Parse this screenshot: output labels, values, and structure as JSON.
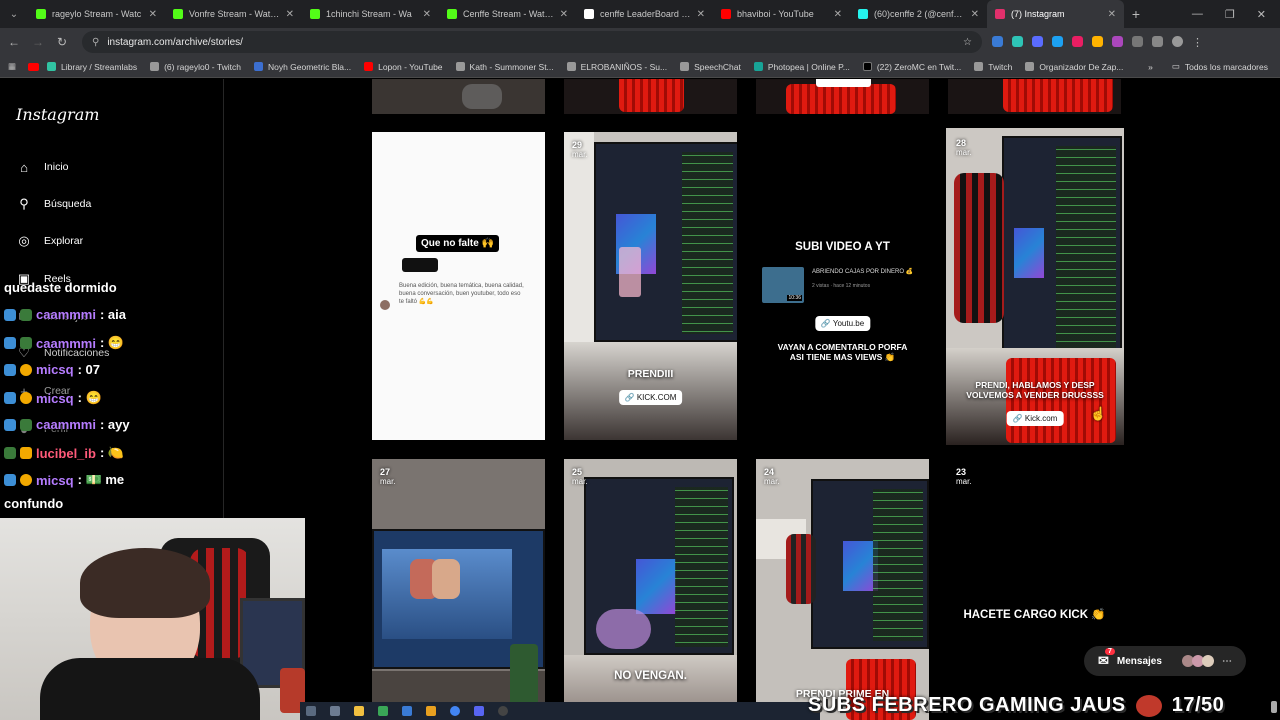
{
  "browser": {
    "tabs": [
      {
        "title": "rageylo Stream - Watc",
        "color": "#53fc18"
      },
      {
        "title": "Vonfre Stream - Watch",
        "color": "#53fc18"
      },
      {
        "title": "1chinchi Stream - Wa",
        "color": "#53fc18"
      },
      {
        "title": "Cenffe Stream - Watch Li",
        "color": "#53fc18"
      },
      {
        "title": "cenffe LeaderBoard | The",
        "color": "#ffffff"
      },
      {
        "title": "bhaviboi - YouTube",
        "color": "#ff0000"
      },
      {
        "title": "(60)cenffe 2 (@cenffe2) |",
        "color": "#25f4ee"
      },
      {
        "title": "(7) Instagram",
        "color": "#e1306c"
      }
    ],
    "url": "instagram.com/archive/stories/",
    "bookmarks": [
      "Library / Streamlabs",
      "(6) rageylo0 - Twitch",
      "Noyh Geometric Bla...",
      "Lopon - YouTube",
      "Kath - Summoner St...",
      "ELROBANIÑOS - Su...",
      "SpeechChat",
      "Photopea | Online P...",
      "(22) ZeroMC en Twit...",
      "Twitch",
      "Organizador De Zap..."
    ],
    "bookmarks_folder": "Todos los marcadores"
  },
  "sidebar": {
    "logo": "Instagram",
    "items": [
      {
        "label": "Inicio",
        "icon": "home-icon"
      },
      {
        "label": "Búsqueda",
        "icon": "search-icon"
      },
      {
        "label": "Explorar",
        "icon": "compass-icon"
      },
      {
        "label": "Reels",
        "icon": "reels-icon"
      },
      {
        "label": "Mensajes",
        "icon": "messenger-icon"
      },
      {
        "label": "Notificaciones",
        "icon": "heart-icon"
      },
      {
        "label": "Crear",
        "icon": "plus-icon"
      },
      {
        "label": "Perfil",
        "icon": "profile-icon"
      }
    ]
  },
  "stories": [
    {
      "day": "",
      "month": "",
      "caption": "Que no falte 🙌",
      "text": "Buena edición, buena temática, buena calidad, buena conversación, buen youtuber, todo eso te faltó 💪💪"
    },
    {
      "day": "29",
      "month": "mar.",
      "caption": "PRENDIII",
      "link": "KICK.COM"
    },
    {
      "day": "",
      "month": "",
      "caption": "SUBI VIDEO A YT",
      "video_title": "ABRIENDO CAJAS POR DINERO 💰",
      "video_meta": "2 vistas · hace 12 minutos",
      "duration": "10:36",
      "link": "Youtu.be",
      "subcaption": "VAYAN A COMENTARLO PORFA ASI TIENE MAS VIEWS 👏"
    },
    {
      "day": "28",
      "month": "mar.",
      "caption": "PRENDI, HABLAMOS Y DESP VOLVEMOS A VENDER DRUGSSS",
      "link": "Kick.com"
    },
    {
      "day": "27",
      "month": "mar."
    },
    {
      "day": "25",
      "month": "mar.",
      "caption": "NO VENGAN."
    },
    {
      "day": "24",
      "month": "mar.",
      "caption": "PRENDI PRIME EN"
    },
    {
      "day": "23",
      "month": "mar.",
      "caption": "HACETE CARGO KICK 👏"
    }
  ],
  "messages_button": {
    "label": "Mensajes",
    "badge": "7"
  },
  "overlay": {
    "chat": [
      {
        "user": "",
        "text": "quedaste dormido"
      },
      {
        "user": "caammmi",
        "text": ": aia"
      },
      {
        "user": "caammmi",
        "text": ": 😁"
      },
      {
        "user": "micsq",
        "text": ": 07"
      },
      {
        "user": "micsq",
        "text": ": 😁"
      },
      {
        "user": "caammmi",
        "text": ": ayy"
      },
      {
        "user": "lucibel_ib",
        "text": ": 🍋"
      },
      {
        "user": "micsq",
        "text": ": 💵 me"
      },
      {
        "user": "",
        "text": "confundo"
      }
    ],
    "subs_text": "SUBS FEBRERO GAMING JAUS",
    "subs_count": "17/50"
  }
}
